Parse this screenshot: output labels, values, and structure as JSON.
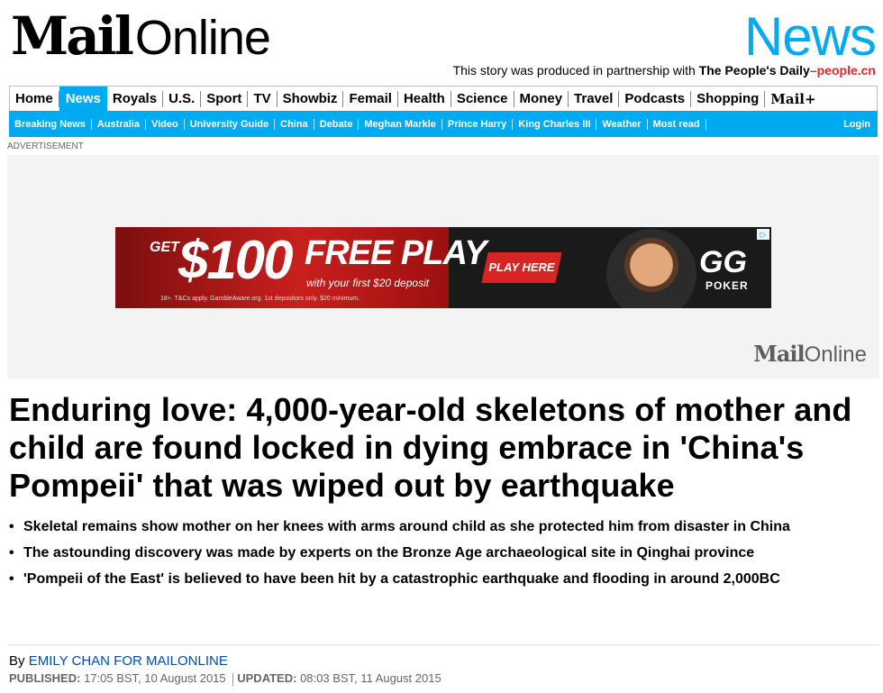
{
  "masthead": {
    "logo_mail": "Mail",
    "logo_online": "Online",
    "channel": "News",
    "partnership_text": "This story was produced in partnership with ",
    "partner_name": "The People's Daily",
    "partner_dash": "–",
    "partner_site": "people.cn"
  },
  "nav_primary": {
    "items": [
      "Home",
      "News",
      "Royals",
      "U.S.",
      "Sport",
      "TV",
      "Showbiz",
      "Femail",
      "Health",
      "Science",
      "Money",
      "Travel",
      "Podcasts",
      "Shopping"
    ],
    "active": "News",
    "mailplus": "Mail+"
  },
  "nav_secondary": {
    "items": [
      "Breaking News",
      "Australia",
      "Video",
      "University Guide",
      "China",
      "Debate",
      "Meghan Markle",
      "Prince Harry",
      "King Charles III",
      "Weather",
      "Most read"
    ],
    "login": "Login"
  },
  "ad": {
    "label": "ADVERTISEMENT",
    "banner_get": "GET",
    "banner_amount": "$100",
    "banner_free": "FREE PLAY",
    "banner_deposit": "with your first $20 deposit",
    "banner_terms": "18+. T&Cs apply. GambleAware.org. 1st depositors only. $20 minimum.",
    "banner_cta": "PLAY HERE",
    "banner_brand": "GG",
    "banner_brand_sub": "POKER",
    "adchoices": "▷",
    "area_logo_mail": "Mail",
    "area_logo_online": "Online"
  },
  "article": {
    "headline": "Enduring love: 4,000-year-old skeletons of mother and child are found locked in dying embrace in 'China's Pompeii' that was wiped out by earthquake",
    "bullets": [
      "Skeletal remains show mother on her knees with arms around child as she protected him from disaster in China",
      "The astounding discovery was made by experts on the Bronze Age archaeological site in Qinghai province",
      " 'Pompeii of the East' is believed to have been hit by a catastrophic earthquake and flooding in around 2,000BC"
    ],
    "byline_prefix": "By ",
    "author": "EMILY CHAN FOR MAILONLINE",
    "published_label": "PUBLISHED:",
    "published": " 17:05 BST, 10 August 2015 ",
    "updated_label": "UPDATED:",
    "updated": " 08:03 BST, 11 August 2015"
  },
  "colors": {
    "accent": "#00aaf0",
    "partner_red": "#e0282e",
    "author_link": "#004db3"
  }
}
